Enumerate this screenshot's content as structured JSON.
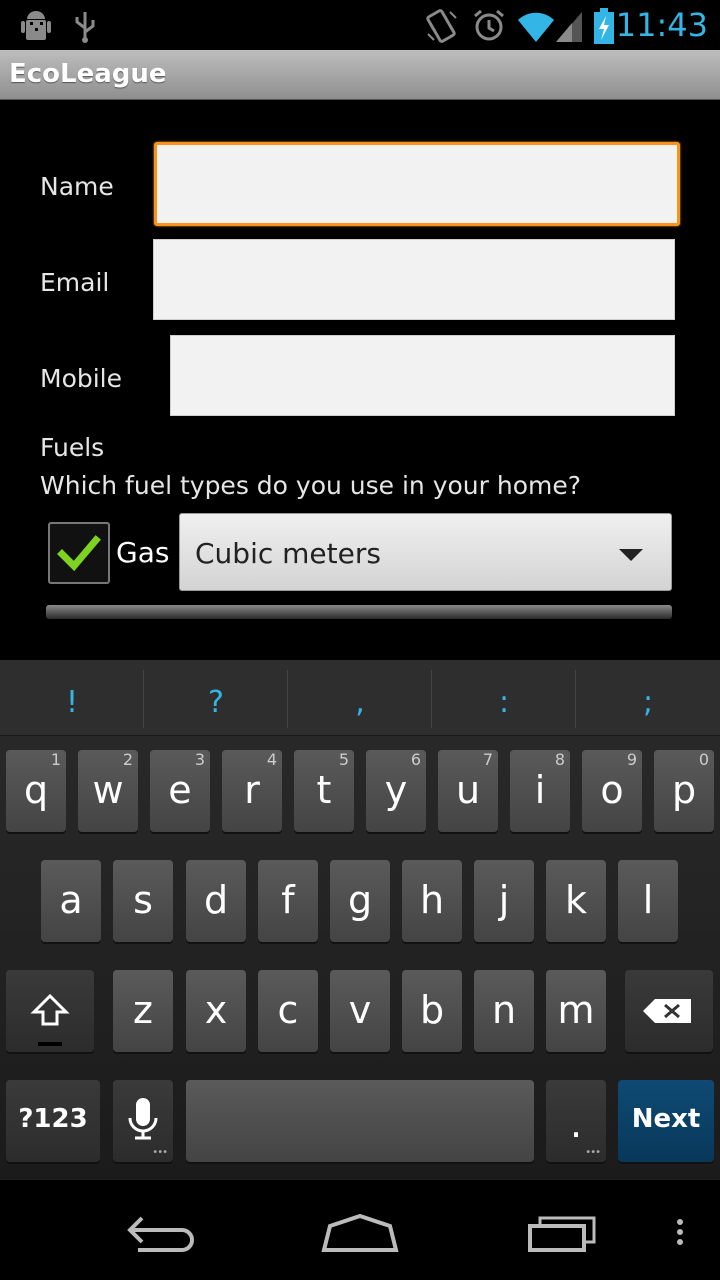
{
  "status_bar": {
    "time": "11:43",
    "icons": [
      "android-debug-icon",
      "usb-icon",
      "vibrate-icon",
      "alarm-icon",
      "wifi-icon",
      "signal-icon",
      "battery-charging-icon"
    ]
  },
  "app": {
    "title": "EcoLeague"
  },
  "form": {
    "name_label": "Name",
    "name_value": "",
    "email_label": "Email",
    "email_value": "",
    "mobile_label": "Mobile",
    "mobile_value": "",
    "fuels_title": "Fuels",
    "fuels_question": "Which fuel types do you use in your home?",
    "gas_label": "Gas",
    "gas_checked": true,
    "gas_unit_selected": "Cubic meters"
  },
  "keyboard": {
    "suggestions": [
      "!",
      "?",
      ",",
      ":",
      ";"
    ],
    "row1": [
      {
        "key": "q",
        "hint": "1"
      },
      {
        "key": "w",
        "hint": "2"
      },
      {
        "key": "e",
        "hint": "3"
      },
      {
        "key": "r",
        "hint": "4"
      },
      {
        "key": "t",
        "hint": "5"
      },
      {
        "key": "y",
        "hint": "6"
      },
      {
        "key": "u",
        "hint": "7"
      },
      {
        "key": "i",
        "hint": "8"
      },
      {
        "key": "o",
        "hint": "9"
      },
      {
        "key": "p",
        "hint": "0"
      }
    ],
    "row2": [
      "a",
      "s",
      "d",
      "f",
      "g",
      "h",
      "j",
      "k",
      "l"
    ],
    "row3": [
      "z",
      "x",
      "c",
      "v",
      "b",
      "n",
      "m"
    ],
    "symbols_label": "?123",
    "period_label": ".",
    "action_label": "Next"
  },
  "colors": {
    "accent": "#33b5e5",
    "focus": "#f7941d",
    "check": "#7ed321",
    "next_key": "#0e4a74"
  }
}
